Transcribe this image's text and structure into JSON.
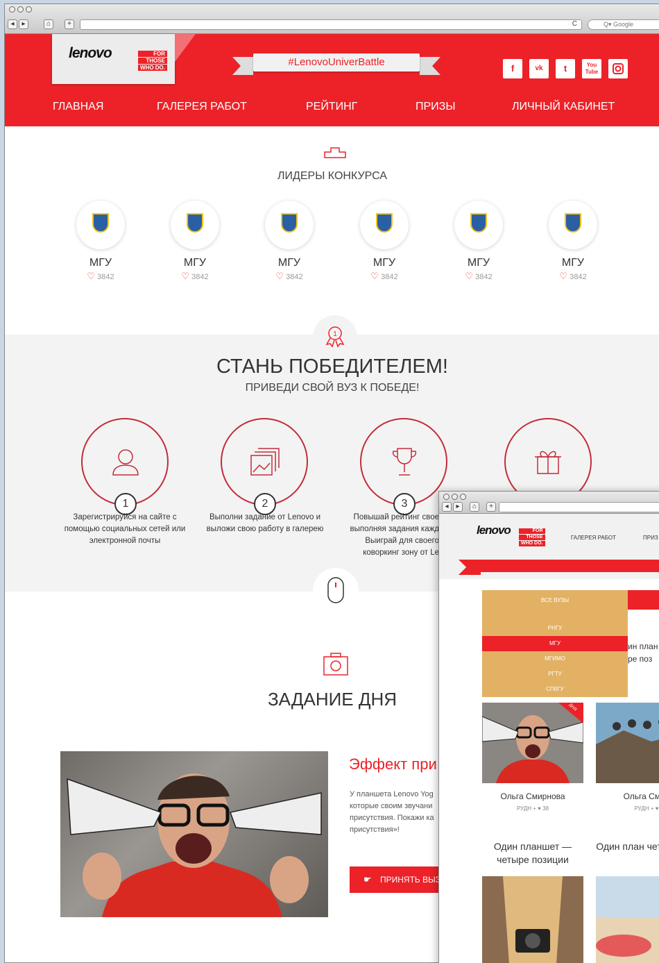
{
  "browser": {
    "search_placeholder": "Q▾ Google",
    "reload_glyph": "C"
  },
  "header": {
    "logo_text": "lenovo",
    "logo_tag": [
      "FOR",
      "THOSE",
      "WHO DO."
    ],
    "hashtag": "#LenovoUniverBattle",
    "social": [
      "f",
      "vk",
      "t",
      "You Tube",
      "ig"
    ],
    "nav": [
      "ГЛАВНАЯ",
      "ГАЛЕРЕЯ РАБОТ",
      "РЕЙТИНГ",
      "ПРИЗЫ",
      "ЛИЧНЫЙ КАБИНЕТ"
    ]
  },
  "leaders": {
    "title": "ЛИДЕРЫ КОНКУРСА",
    "items": [
      {
        "name": "МГУ",
        "likes": "3842"
      },
      {
        "name": "МГУ",
        "likes": "3842"
      },
      {
        "name": "МГУ",
        "likes": "3842"
      },
      {
        "name": "МГУ",
        "likes": "3842"
      },
      {
        "name": "МГУ",
        "likes": "3842"
      },
      {
        "name": "МГУ",
        "likes": "3842"
      }
    ]
  },
  "winner": {
    "title": "СТАНЬ ПОБЕДИТЕЛЕМ!",
    "subtitle": "ПРИВЕДИ СВОЙ ВУЗ К ПОБЕДЕ!",
    "steps": [
      {
        "num": "1",
        "text": "Зарегистрируйся на сайте с помощью социальных сетей или электронной почты"
      },
      {
        "num": "2",
        "text": "Выполни задание от Lenovo и выложи свою работу в галерею"
      },
      {
        "num": "3",
        "text": "Повышай рейтинг свое выполняя задания кажд Выиграй для своего коворкинг зону от Le"
      }
    ]
  },
  "task": {
    "title": "ЗАДАНИЕ ДНЯ",
    "heading": "Эффект при",
    "text": "У планшета Lenovo Yog которые своим звучани присутствия. Покажи ка присутствия»!",
    "button": "ПРИНЯТЬ ВЫЗ"
  },
  "second": {
    "logo_text": "lenovo",
    "logo_tag": [
      "FOR",
      "THOSE",
      "WHO DO."
    ],
    "nav": [
      "ГАЛЕРЕЯ РАБОТ",
      "ПРИЗ"
    ],
    "dropdown": [
      "ВСЕ ВУЗЫ",
      "РНГУ",
      "МГУ",
      "МГИМО",
      "РГТУ",
      "СПбГУ"
    ],
    "dropdown_active": "МГУ",
    "behind_text": "ин план ре поз",
    "ribbon_tag": "ДНЯ",
    "cards": [
      {
        "name": "Ольга Смирнова",
        "meta": "РУДН + ♥ 38",
        "title": "Один планшет — четыре позиции"
      },
      {
        "name": "Ольга Смир",
        "meta": "РУДН + ♥",
        "title": "Один план четыре поз"
      }
    ]
  }
}
